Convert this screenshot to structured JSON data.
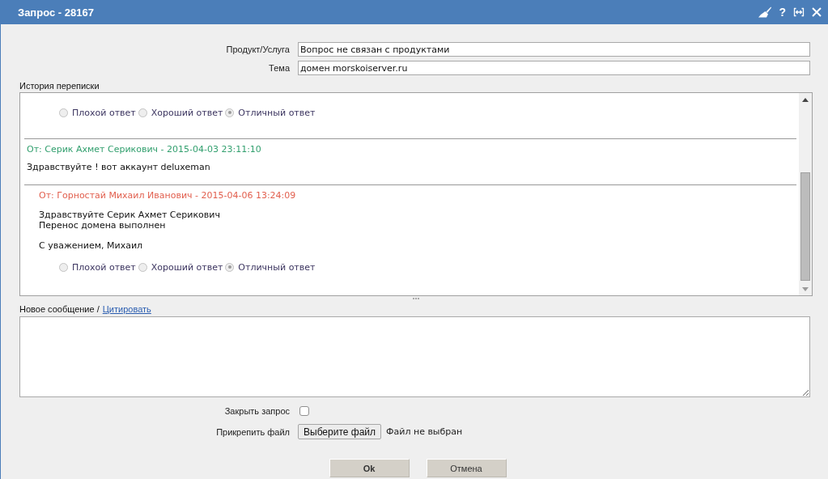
{
  "window": {
    "title": "Запрос - 28167",
    "help": "?"
  },
  "fields": [
    {
      "label": "Продукт/Услуга",
      "value": "Вопрос не связан с продуктами"
    },
    {
      "label": "Тема",
      "value": "домен morskoiserver.ru"
    }
  ],
  "history": {
    "label": "История переписки",
    "messages": [
      {
        "kind": "staff",
        "rating": {
          "disabled": true,
          "options": [
            {
              "label": "Плохой ответ",
              "selected": false
            },
            {
              "label": "Хороший ответ",
              "selected": false
            },
            {
              "label": "Отличный ответ",
              "selected": true
            }
          ]
        }
      },
      {
        "kind": "client",
        "color": "#33a06f",
        "author": "От: Серик Ахмет Серикович - 2015-04-03 23:11:10",
        "paragraphs": [
          [
            "Здравствуйте ! вот аккаунт deluxeman"
          ]
        ]
      },
      {
        "kind": "staff",
        "color": "#e2604f",
        "author": "От: Горностай Михаил Иванович - 2015-04-06 13:24:09",
        "paragraphs": [
          [
            "Здравствуйте Серик Ахмет Серикович",
            "Перенос домена выполнен"
          ],
          [
            "С уважением, Михаил"
          ]
        ],
        "rating": {
          "disabled": true,
          "options": [
            {
              "label": "Плохой ответ",
              "selected": false
            },
            {
              "label": "Хороший ответ",
              "selected": false
            },
            {
              "label": "Отличный ответ",
              "selected": true
            }
          ]
        }
      }
    ]
  },
  "new_message": {
    "label": "Новое сообщение /",
    "quote_link": "Цитировать"
  },
  "close_request": {
    "label": "Закрыть запрос",
    "checked": false
  },
  "attachment": {
    "label": "Прикрепить файл",
    "button": "Выберите файл",
    "status": "Файл не выбран"
  },
  "buttons": [
    {
      "label": "Ok",
      "kind": "primary"
    },
    {
      "label": "Отмена",
      "kind": "secondary"
    }
  ]
}
